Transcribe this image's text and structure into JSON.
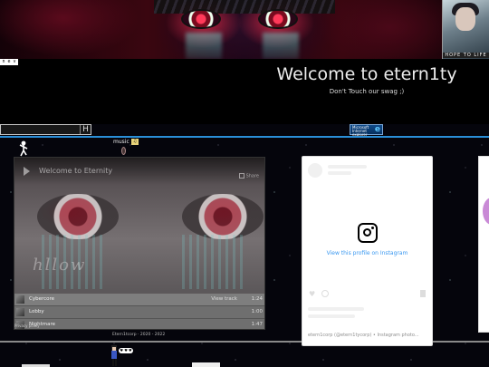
{
  "banner": {
    "corner_caption": "HOPE TO LIFE",
    "new_badge": "n e v"
  },
  "header": {
    "title": "Welcome to etern1ty",
    "tagline": "Don't Touch our swag ;)"
  },
  "nav": {
    "search_button": "H",
    "ie_badge": {
      "line1": "Microsoft",
      "line2": "Internet",
      "line3": "explorer",
      "glyph": "e"
    }
  },
  "music": {
    "label": "music",
    "icon_glyph": "♫"
  },
  "player": {
    "title": "Welcome to Eternity",
    "share_label": "Share",
    "cover_scribble": "hllow",
    "tracks": [
      {
        "name": "Cybercore",
        "plays": "View track",
        "duration": "1:24"
      },
      {
        "name": "Lobby",
        "plays": "",
        "duration": "1:00"
      },
      {
        "name": "Nightmare",
        "plays": "",
        "duration": "1:47"
      }
    ],
    "privacy": "Privacy policy"
  },
  "footer": {
    "copyright": "Etern1tcorp · 2020 - 2022",
    "sprite_bubble": "♥ ♥ ♥"
  },
  "instagram": {
    "link": "View this profile on Instagram",
    "footer": "etern1corp (@etern1tycorp) • Instagram photo..."
  },
  "colors": {
    "accent_blue": "#2a8fd8",
    "instagram_link": "#3897f0",
    "header_red": "#dc2846"
  }
}
